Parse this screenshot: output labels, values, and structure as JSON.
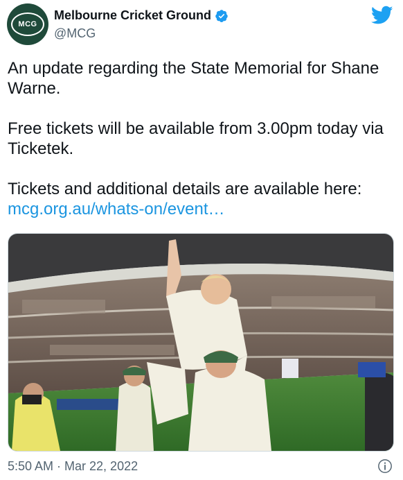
{
  "account": {
    "avatar_text": "MCG",
    "display_name": "Melbourne Cricket Ground",
    "handle": "@MCG",
    "verified": true
  },
  "tweet": {
    "line1": "An update regarding the State Memorial for Shane Warne.",
    "line2": "Free tickets will be available from 3.00pm today via Ticketek.",
    "line3": "Tickets and additional details are available here:",
    "link": "mcg.org.au/whats-on/event…"
  },
  "footer": {
    "timestamp": "5:50 AM · Mar 22, 2022"
  },
  "colors": {
    "link": "#1b95e0",
    "brand_bird": "#1da1f2",
    "avatar_bg": "#1f4a3a"
  },
  "icons": [
    "verified-badge-icon",
    "twitter-bird-icon",
    "info-icon"
  ]
}
